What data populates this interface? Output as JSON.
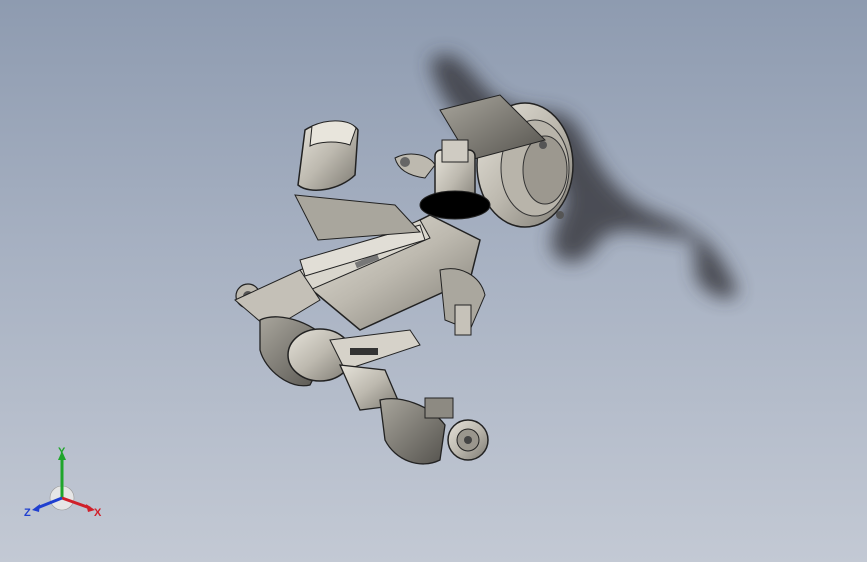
{
  "viewport": {
    "background_top": "#8e9bb0",
    "background_bottom": "#c3c9d4"
  },
  "model": {
    "type": "industrial-robot-arm",
    "colors": {
      "body": "#c9c6bd",
      "shade": "#8e8b84",
      "edge": "#2a2a2a",
      "shadow": "#3f4045"
    }
  },
  "triad": {
    "x_label": "X",
    "y_label": "Y",
    "z_label": "Z",
    "x_color": "#d0202a",
    "y_color": "#1fa52b",
    "z_color": "#1f3fd0"
  }
}
